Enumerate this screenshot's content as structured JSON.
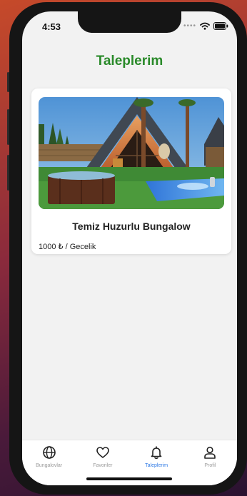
{
  "status_bar": {
    "time": "4:53"
  },
  "header": {
    "title": "Taleplerim"
  },
  "listing": {
    "title": "Temiz Huzurlu Bungalow",
    "price": "1000 ₺ / Gecelik",
    "image_icon": "bungalow-photo"
  },
  "tab_bar": {
    "items": [
      {
        "label": "Bungalovlar",
        "icon": "globe-icon",
        "active": false
      },
      {
        "label": "Favoriler",
        "icon": "heart-icon",
        "active": false
      },
      {
        "label": "Taleplerim",
        "icon": "bell-icon",
        "active": true
      },
      {
        "label": "Profil",
        "icon": "person-icon",
        "active": false
      }
    ]
  },
  "colors": {
    "title_green": "#2a8a2a",
    "active_tab_blue": "#2f7ae5",
    "inactive_tab_gray": "#9a9a9a"
  }
}
